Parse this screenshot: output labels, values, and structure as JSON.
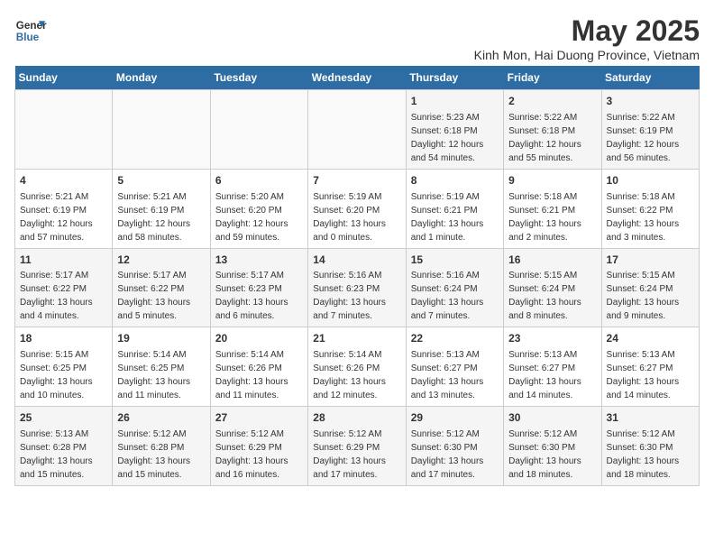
{
  "logo": {
    "line1": "General",
    "line2": "Blue"
  },
  "title": "May 2025",
  "subtitle": "Kinh Mon, Hai Duong Province, Vietnam",
  "weekdays": [
    "Sunday",
    "Monday",
    "Tuesday",
    "Wednesday",
    "Thursday",
    "Friday",
    "Saturday"
  ],
  "weeks": [
    [
      {
        "day": "",
        "info": ""
      },
      {
        "day": "",
        "info": ""
      },
      {
        "day": "",
        "info": ""
      },
      {
        "day": "",
        "info": ""
      },
      {
        "day": "1",
        "info": "Sunrise: 5:23 AM\nSunset: 6:18 PM\nDaylight: 12 hours\nand 54 minutes."
      },
      {
        "day": "2",
        "info": "Sunrise: 5:22 AM\nSunset: 6:18 PM\nDaylight: 12 hours\nand 55 minutes."
      },
      {
        "day": "3",
        "info": "Sunrise: 5:22 AM\nSunset: 6:19 PM\nDaylight: 12 hours\nand 56 minutes."
      }
    ],
    [
      {
        "day": "4",
        "info": "Sunrise: 5:21 AM\nSunset: 6:19 PM\nDaylight: 12 hours\nand 57 minutes."
      },
      {
        "day": "5",
        "info": "Sunrise: 5:21 AM\nSunset: 6:19 PM\nDaylight: 12 hours\nand 58 minutes."
      },
      {
        "day": "6",
        "info": "Sunrise: 5:20 AM\nSunset: 6:20 PM\nDaylight: 12 hours\nand 59 minutes."
      },
      {
        "day": "7",
        "info": "Sunrise: 5:19 AM\nSunset: 6:20 PM\nDaylight: 13 hours\nand 0 minutes."
      },
      {
        "day": "8",
        "info": "Sunrise: 5:19 AM\nSunset: 6:21 PM\nDaylight: 13 hours\nand 1 minute."
      },
      {
        "day": "9",
        "info": "Sunrise: 5:18 AM\nSunset: 6:21 PM\nDaylight: 13 hours\nand 2 minutes."
      },
      {
        "day": "10",
        "info": "Sunrise: 5:18 AM\nSunset: 6:22 PM\nDaylight: 13 hours\nand 3 minutes."
      }
    ],
    [
      {
        "day": "11",
        "info": "Sunrise: 5:17 AM\nSunset: 6:22 PM\nDaylight: 13 hours\nand 4 minutes."
      },
      {
        "day": "12",
        "info": "Sunrise: 5:17 AM\nSunset: 6:22 PM\nDaylight: 13 hours\nand 5 minutes."
      },
      {
        "day": "13",
        "info": "Sunrise: 5:17 AM\nSunset: 6:23 PM\nDaylight: 13 hours\nand 6 minutes."
      },
      {
        "day": "14",
        "info": "Sunrise: 5:16 AM\nSunset: 6:23 PM\nDaylight: 13 hours\nand 7 minutes."
      },
      {
        "day": "15",
        "info": "Sunrise: 5:16 AM\nSunset: 6:24 PM\nDaylight: 13 hours\nand 7 minutes."
      },
      {
        "day": "16",
        "info": "Sunrise: 5:15 AM\nSunset: 6:24 PM\nDaylight: 13 hours\nand 8 minutes."
      },
      {
        "day": "17",
        "info": "Sunrise: 5:15 AM\nSunset: 6:24 PM\nDaylight: 13 hours\nand 9 minutes."
      }
    ],
    [
      {
        "day": "18",
        "info": "Sunrise: 5:15 AM\nSunset: 6:25 PM\nDaylight: 13 hours\nand 10 minutes."
      },
      {
        "day": "19",
        "info": "Sunrise: 5:14 AM\nSunset: 6:25 PM\nDaylight: 13 hours\nand 11 minutes."
      },
      {
        "day": "20",
        "info": "Sunrise: 5:14 AM\nSunset: 6:26 PM\nDaylight: 13 hours\nand 11 minutes."
      },
      {
        "day": "21",
        "info": "Sunrise: 5:14 AM\nSunset: 6:26 PM\nDaylight: 13 hours\nand 12 minutes."
      },
      {
        "day": "22",
        "info": "Sunrise: 5:13 AM\nSunset: 6:27 PM\nDaylight: 13 hours\nand 13 minutes."
      },
      {
        "day": "23",
        "info": "Sunrise: 5:13 AM\nSunset: 6:27 PM\nDaylight: 13 hours\nand 14 minutes."
      },
      {
        "day": "24",
        "info": "Sunrise: 5:13 AM\nSunset: 6:27 PM\nDaylight: 13 hours\nand 14 minutes."
      }
    ],
    [
      {
        "day": "25",
        "info": "Sunrise: 5:13 AM\nSunset: 6:28 PM\nDaylight: 13 hours\nand 15 minutes."
      },
      {
        "day": "26",
        "info": "Sunrise: 5:12 AM\nSunset: 6:28 PM\nDaylight: 13 hours\nand 15 minutes."
      },
      {
        "day": "27",
        "info": "Sunrise: 5:12 AM\nSunset: 6:29 PM\nDaylight: 13 hours\nand 16 minutes."
      },
      {
        "day": "28",
        "info": "Sunrise: 5:12 AM\nSunset: 6:29 PM\nDaylight: 13 hours\nand 17 minutes."
      },
      {
        "day": "29",
        "info": "Sunrise: 5:12 AM\nSunset: 6:30 PM\nDaylight: 13 hours\nand 17 minutes."
      },
      {
        "day": "30",
        "info": "Sunrise: 5:12 AM\nSunset: 6:30 PM\nDaylight: 13 hours\nand 18 minutes."
      },
      {
        "day": "31",
        "info": "Sunrise: 5:12 AM\nSunset: 6:30 PM\nDaylight: 13 hours\nand 18 minutes."
      }
    ]
  ]
}
